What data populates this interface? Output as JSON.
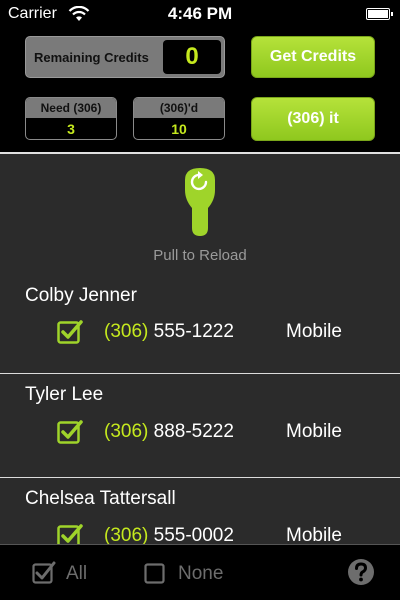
{
  "status_bar": {
    "carrier": "Carrier",
    "time": "4:46 PM"
  },
  "header": {
    "remaining_credits_label": "Remaining Credits",
    "remaining_credits_value": "0",
    "get_credits_label": "Get Credits",
    "need_label": "Need (306)",
    "need_value": "3",
    "called_label": "(306)'d",
    "called_value": "10",
    "dial_button_label": "(306) it"
  },
  "pull_to_reload": {
    "text": "Pull to Reload"
  },
  "contacts": [
    {
      "name": "Colby Jenner",
      "area": "(306)",
      "number": "555-1222",
      "type": "Mobile",
      "checked": true
    },
    {
      "name": "Tyler Lee",
      "area": "(306)",
      "number": "888-5222",
      "type": "Mobile",
      "checked": true
    },
    {
      "name": "Chelsea Tattersall",
      "area": "(306)",
      "number": "555-0002",
      "type": "Mobile",
      "checked": true
    }
  ],
  "bottom_bar": {
    "all_label": "All",
    "none_label": "None",
    "all_checked": true,
    "none_checked": false
  },
  "colors": {
    "accent": "#c5e91e",
    "button_green": "#9fd42a",
    "background": "#2b2b2b"
  },
  "icons": [
    "wifi-icon",
    "battery-icon",
    "reload-icon",
    "checkbox-icon",
    "help-icon"
  ]
}
